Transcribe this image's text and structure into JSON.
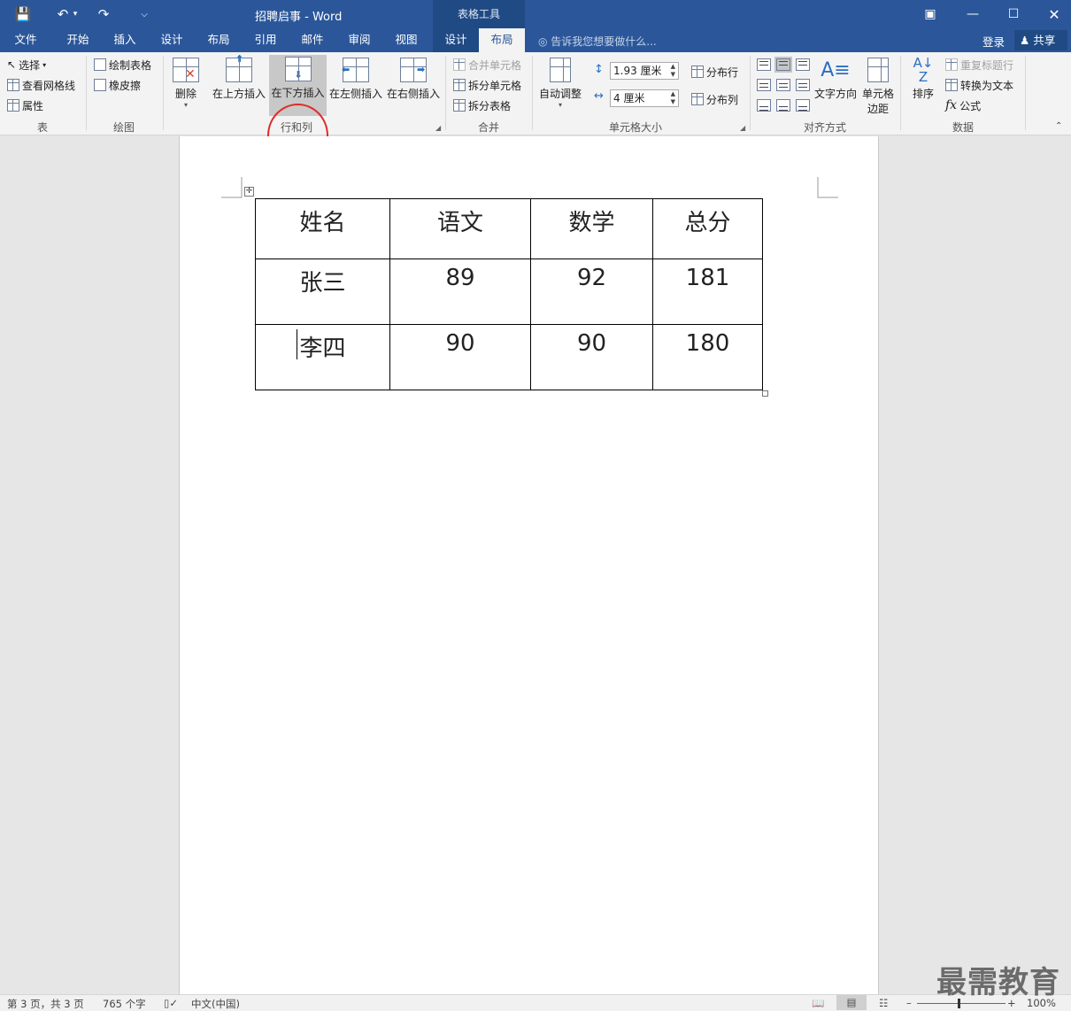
{
  "title_bar": {
    "doc_title": "招聘启事 - Word",
    "tools_title": "表格工具"
  },
  "tabs": [
    "文件",
    "开始",
    "插入",
    "设计",
    "布局",
    "引用",
    "邮件",
    "审阅",
    "视图",
    "设计",
    "布局"
  ],
  "active_tab_index": 10,
  "tell_me": "告诉我您想要做什么...",
  "signin": "登录",
  "share": "共享",
  "ribbon": {
    "group_table": {
      "label": "表",
      "select": "选择",
      "view_gridlines": "查看网格线",
      "properties": "属性"
    },
    "group_draw": {
      "label": "绘图",
      "draw_table": "绘制表格",
      "eraser": "橡皮擦"
    },
    "group_rows_cols": {
      "label": "行和列",
      "delete": "删除",
      "insert_above": "在上方插入",
      "insert_below": "在下方插入",
      "insert_left": "在左侧插入",
      "insert_right": "在右侧插入"
    },
    "group_merge": {
      "label": "合并",
      "merge_cells": "合并单元格",
      "split_cells": "拆分单元格",
      "split_table": "拆分表格"
    },
    "group_cell_size": {
      "label": "单元格大小",
      "autofit": "自动调整",
      "height_value": "1.93 厘米",
      "width_value": "4 厘米",
      "distribute_rows": "分布行",
      "distribute_cols": "分布列"
    },
    "group_alignment": {
      "label": "对齐方式",
      "text_direction": "文字方向",
      "cell_margins_1": "单元格",
      "cell_margins_2": "边距"
    },
    "group_data": {
      "label": "数据",
      "sort": "排序",
      "repeat_header": "重复标题行",
      "convert_to_text": "转换为文本",
      "formula": "公式"
    }
  },
  "table": {
    "rows": [
      [
        "姓名",
        "语文",
        "数学",
        "总分"
      ],
      [
        "张三",
        "89",
        "92",
        "181"
      ],
      [
        "李四",
        "90",
        "90",
        "180"
      ]
    ]
  },
  "status_bar": {
    "page": "第 3 页，共 3 页",
    "words": "765 个字",
    "language": "中文(中国)",
    "zoom": "100%"
  },
  "watermark": "最需教育"
}
